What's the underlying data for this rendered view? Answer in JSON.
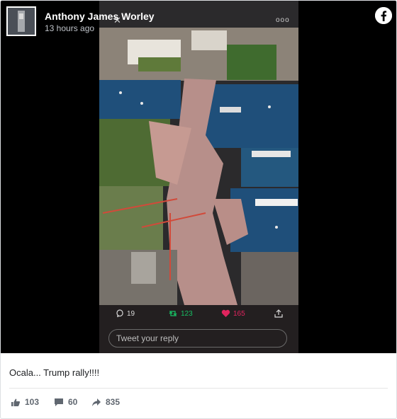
{
  "post": {
    "author_name": "Anthony James Worley",
    "timestamp": "13 hours ago",
    "caption": "Ocala... Trump rally!!!!"
  },
  "embedded_tweet": {
    "replies": "19",
    "retweets": "123",
    "likes": "165",
    "reply_placeholder": "Tweet your reply"
  },
  "stats": {
    "likes": "103",
    "comments": "60",
    "shares": "835"
  },
  "colors": {
    "facebook_blue": "#1877f2",
    "retweet_green": "#17bf63",
    "like_pink": "#e0245e",
    "water": "#1f4f7a"
  },
  "icons": [
    "facebook-logo-icon",
    "reply-icon",
    "retweet-icon",
    "heart-icon",
    "share-icon",
    "like-icon",
    "comment-icon",
    "share-arrow-icon"
  ]
}
